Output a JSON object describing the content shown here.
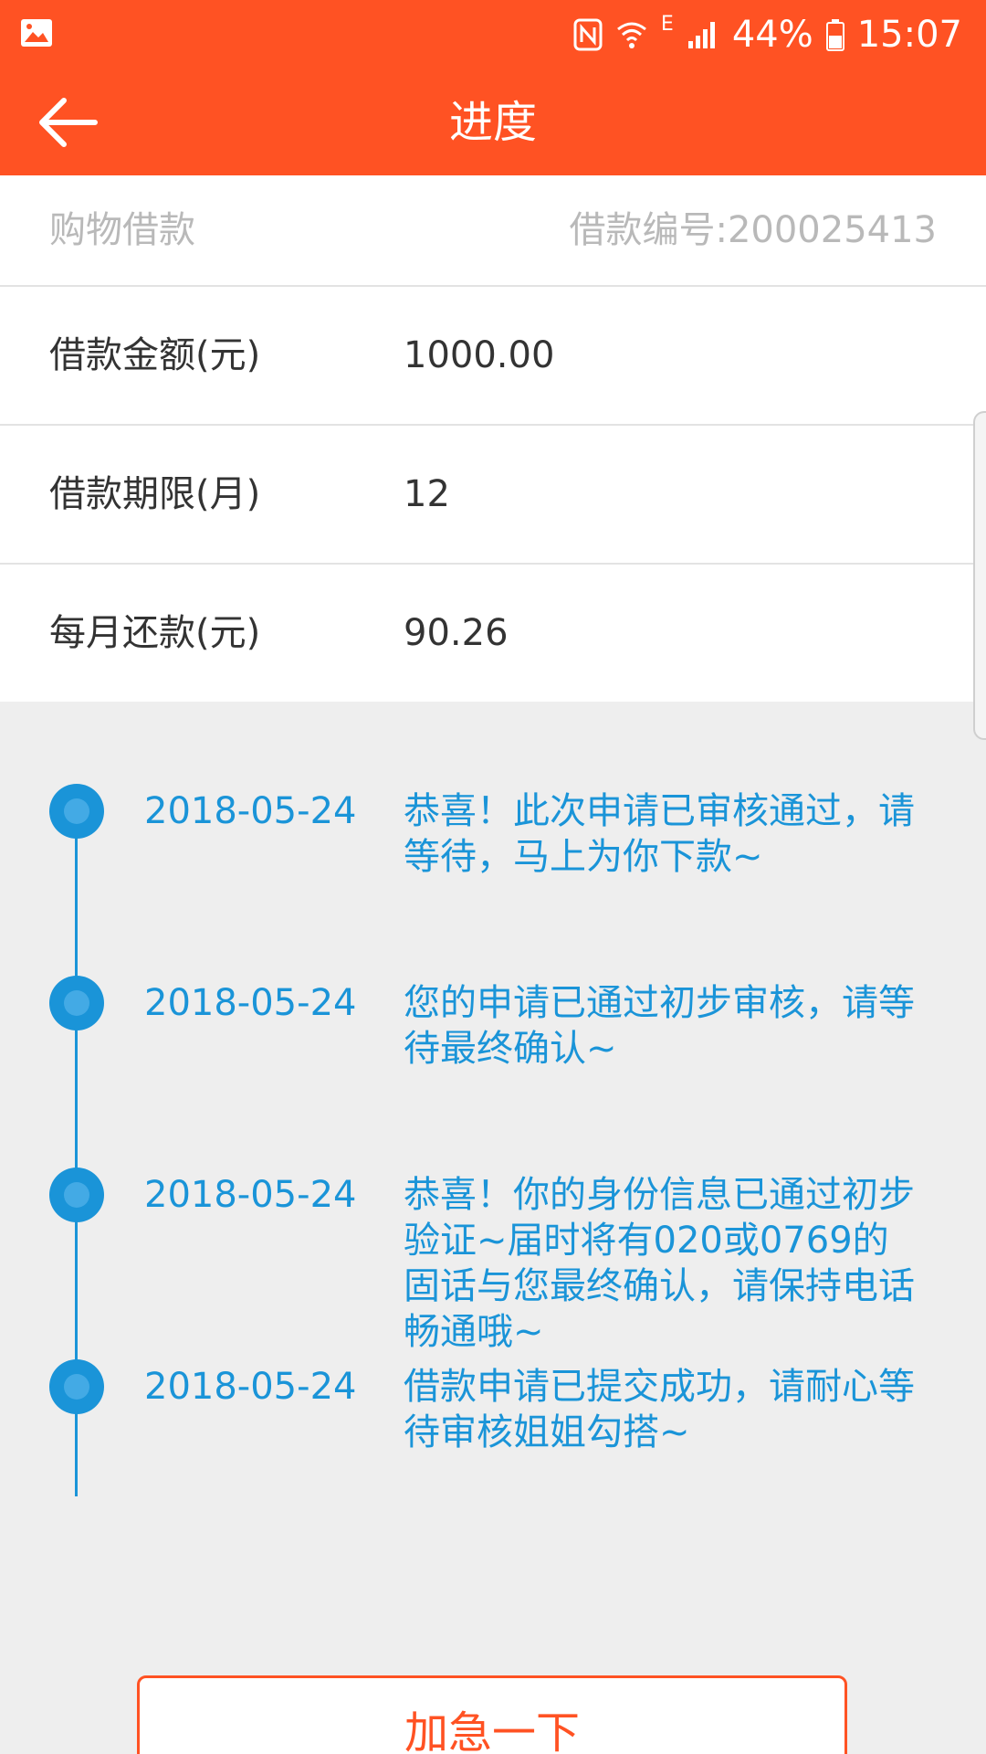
{
  "status": {
    "battery": "44%",
    "time": "15:07",
    "network": "E"
  },
  "header": {
    "title": "进度"
  },
  "info": {
    "type": "购物借款",
    "number": "借款编号:200025413",
    "rows": [
      {
        "label": "借款金额(元)",
        "value": "1000.00"
      },
      {
        "label": "借款期限(月)",
        "value": "12"
      },
      {
        "label": "每月还款(元)",
        "value": "90.26"
      }
    ]
  },
  "timeline": [
    {
      "date": "2018-05-24",
      "message": "恭喜！此次申请已审核通过，请等待，马上为你下款~"
    },
    {
      "date": "2018-05-24",
      "message": "您的申请已通过初步审核，请等待最终确认~"
    },
    {
      "date": "2018-05-24",
      "message": "恭喜！你的身份信息已通过初步验证~届时将有020或0769的固话与您最终确认，请保持电话畅通哦~"
    },
    {
      "date": "2018-05-24",
      "message": "借款申请已提交成功，请耐心等待审核姐姐勾搭~"
    }
  ],
  "actions": {
    "urge_label": "加急一下"
  },
  "colors": {
    "brand": "#ff5223",
    "timeline": "#1a94d8"
  }
}
